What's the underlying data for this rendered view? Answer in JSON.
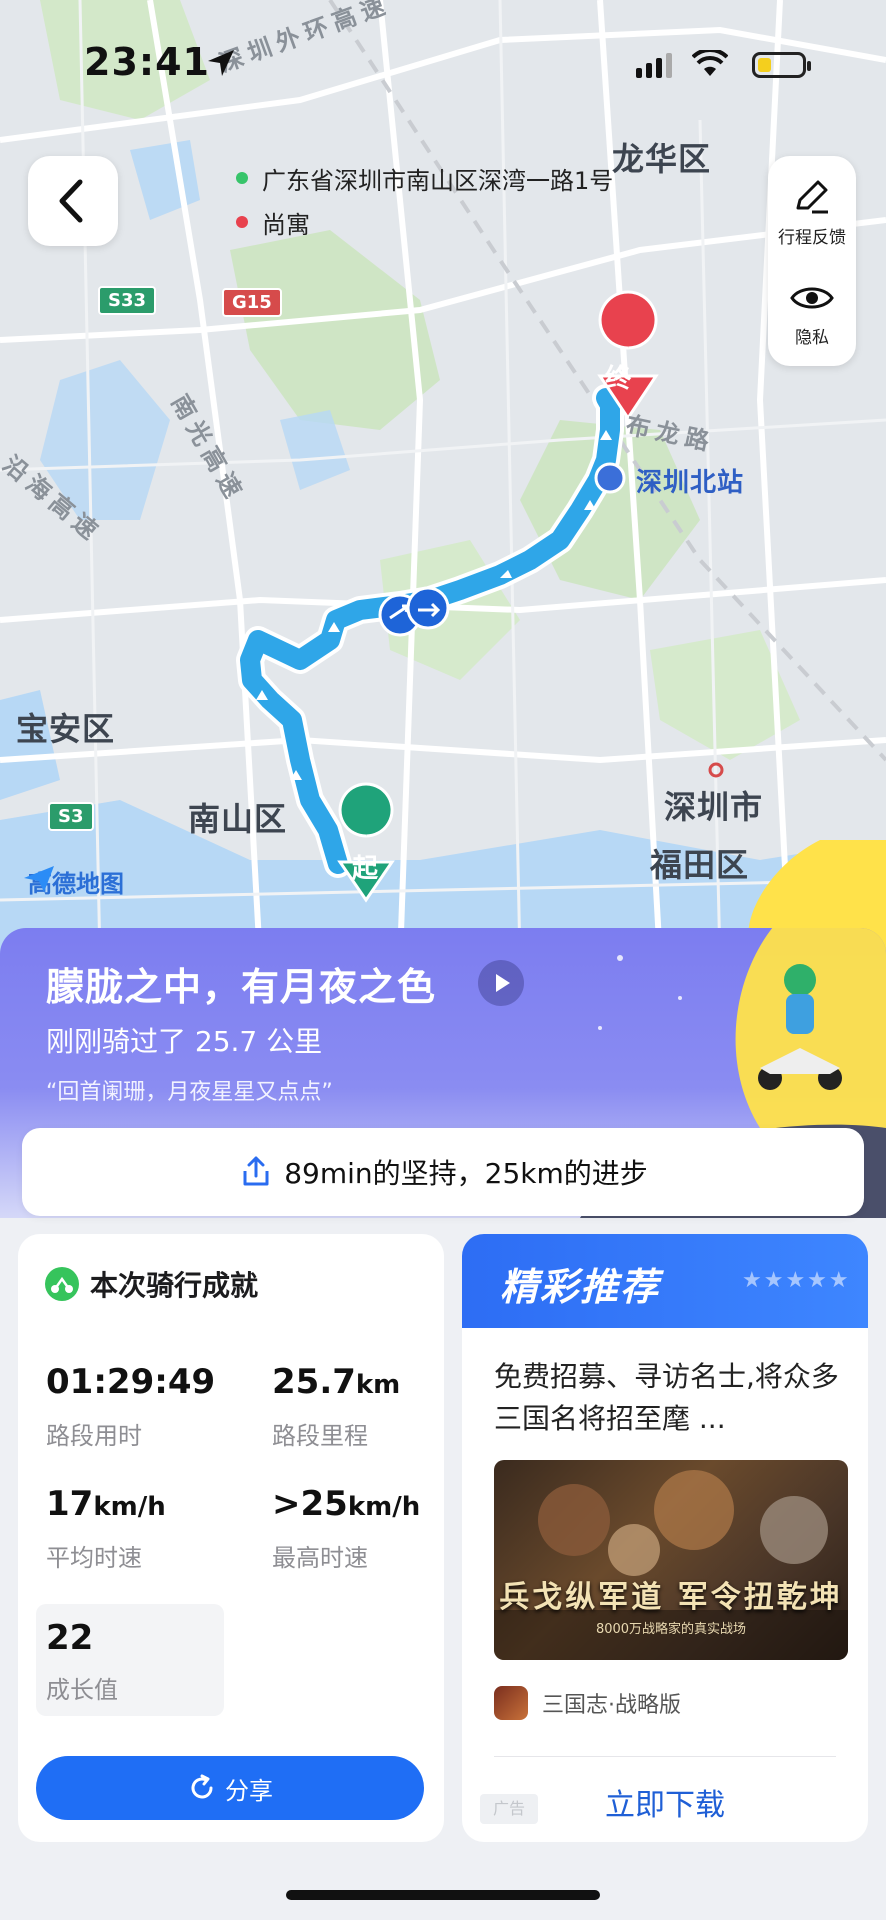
{
  "status_bar": {
    "time": "23:41"
  },
  "map": {
    "origin_address": "广东省深圳市南山区深湾一路1号",
    "destination": "尚寓",
    "districts": [
      "龙华区",
      "宝安区",
      "南山区",
      "深圳市",
      "福田区"
    ],
    "poi": "深圳北站",
    "roads": [
      "深圳外环高速",
      "南光高速",
      "布龙路",
      "沿海高速"
    ],
    "shields": [
      "S33",
      "G15",
      "S3"
    ],
    "start_marker": "起",
    "end_marker": "终",
    "logo_text": "高德地图"
  },
  "side_panel": {
    "feedback_label": "行程反馈",
    "privacy_label": "隐私"
  },
  "banner": {
    "title": "朦胧之中，有月夜之色",
    "subtitle": "刚刚骑过了 25.7 公里",
    "quote": "“回首阑珊，月夜星星又点点”"
  },
  "share_bar": {
    "text": "89min的坚持，25km的进步"
  },
  "achievement": {
    "title": "本次骑行成就",
    "duration": {
      "value": "01:29:49",
      "label": "路段用时"
    },
    "distance": {
      "value": "25.7",
      "unit": "km",
      "label": "路段里程"
    },
    "avg_speed": {
      "value": "17",
      "unit": "km/h",
      "label": "平均时速"
    },
    "max_speed": {
      "value": ">25",
      "unit": "km/h",
      "label": "最高时速"
    },
    "growth": {
      "value": "22",
      "label": "成长值"
    },
    "share_label": "分享"
  },
  "recommend": {
    "title": "精彩推荐",
    "description": "免费招募、寻访名士,将众多三国名将招至麾 ...",
    "ad_slogan": "兵戈纵军道 军令扭乾坤",
    "ad_subtext": "8000万战略家的真实战场",
    "app_name": "三国志·战略版",
    "download_label": "立即下载",
    "ad_tag": "广告"
  },
  "colors": {
    "accent": "#1f6ef5",
    "route": "#2fa6e8",
    "banner": "#7c7df0",
    "end_marker": "#e8424e",
    "start_marker": "#1fa37a"
  }
}
